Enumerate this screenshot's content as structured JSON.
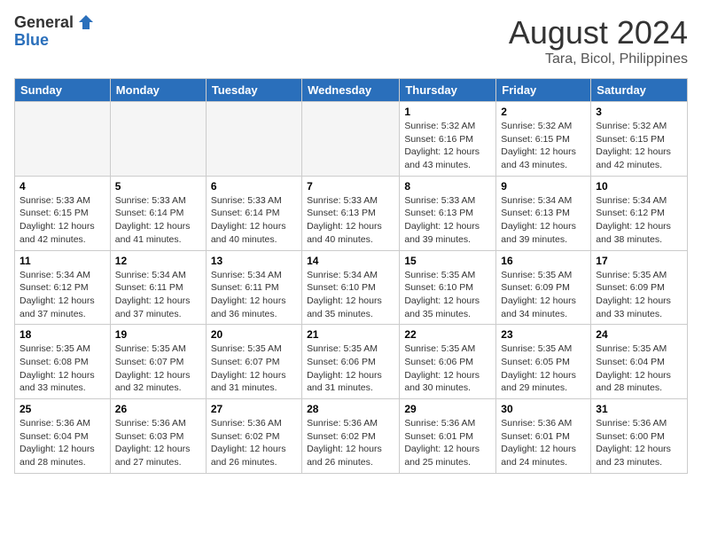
{
  "logo": {
    "general": "General",
    "blue": "Blue"
  },
  "title": {
    "month_year": "August 2024",
    "location": "Tara, Bicol, Philippines"
  },
  "days_of_week": [
    "Sunday",
    "Monday",
    "Tuesday",
    "Wednesday",
    "Thursday",
    "Friday",
    "Saturday"
  ],
  "weeks": [
    [
      {
        "day": "",
        "info": ""
      },
      {
        "day": "",
        "info": ""
      },
      {
        "day": "",
        "info": ""
      },
      {
        "day": "",
        "info": ""
      },
      {
        "day": "1",
        "info": "Sunrise: 5:32 AM\nSunset: 6:16 PM\nDaylight: 12 hours and 43 minutes."
      },
      {
        "day": "2",
        "info": "Sunrise: 5:32 AM\nSunset: 6:15 PM\nDaylight: 12 hours and 43 minutes."
      },
      {
        "day": "3",
        "info": "Sunrise: 5:32 AM\nSunset: 6:15 PM\nDaylight: 12 hours and 42 minutes."
      }
    ],
    [
      {
        "day": "4",
        "info": "Sunrise: 5:33 AM\nSunset: 6:15 PM\nDaylight: 12 hours and 42 minutes."
      },
      {
        "day": "5",
        "info": "Sunrise: 5:33 AM\nSunset: 6:14 PM\nDaylight: 12 hours and 41 minutes."
      },
      {
        "day": "6",
        "info": "Sunrise: 5:33 AM\nSunset: 6:14 PM\nDaylight: 12 hours and 40 minutes."
      },
      {
        "day": "7",
        "info": "Sunrise: 5:33 AM\nSunset: 6:13 PM\nDaylight: 12 hours and 40 minutes."
      },
      {
        "day": "8",
        "info": "Sunrise: 5:33 AM\nSunset: 6:13 PM\nDaylight: 12 hours and 39 minutes."
      },
      {
        "day": "9",
        "info": "Sunrise: 5:34 AM\nSunset: 6:13 PM\nDaylight: 12 hours and 39 minutes."
      },
      {
        "day": "10",
        "info": "Sunrise: 5:34 AM\nSunset: 6:12 PM\nDaylight: 12 hours and 38 minutes."
      }
    ],
    [
      {
        "day": "11",
        "info": "Sunrise: 5:34 AM\nSunset: 6:12 PM\nDaylight: 12 hours and 37 minutes."
      },
      {
        "day": "12",
        "info": "Sunrise: 5:34 AM\nSunset: 6:11 PM\nDaylight: 12 hours and 37 minutes."
      },
      {
        "day": "13",
        "info": "Sunrise: 5:34 AM\nSunset: 6:11 PM\nDaylight: 12 hours and 36 minutes."
      },
      {
        "day": "14",
        "info": "Sunrise: 5:34 AM\nSunset: 6:10 PM\nDaylight: 12 hours and 35 minutes."
      },
      {
        "day": "15",
        "info": "Sunrise: 5:35 AM\nSunset: 6:10 PM\nDaylight: 12 hours and 35 minutes."
      },
      {
        "day": "16",
        "info": "Sunrise: 5:35 AM\nSunset: 6:09 PM\nDaylight: 12 hours and 34 minutes."
      },
      {
        "day": "17",
        "info": "Sunrise: 5:35 AM\nSunset: 6:09 PM\nDaylight: 12 hours and 33 minutes."
      }
    ],
    [
      {
        "day": "18",
        "info": "Sunrise: 5:35 AM\nSunset: 6:08 PM\nDaylight: 12 hours and 33 minutes."
      },
      {
        "day": "19",
        "info": "Sunrise: 5:35 AM\nSunset: 6:07 PM\nDaylight: 12 hours and 32 minutes."
      },
      {
        "day": "20",
        "info": "Sunrise: 5:35 AM\nSunset: 6:07 PM\nDaylight: 12 hours and 31 minutes."
      },
      {
        "day": "21",
        "info": "Sunrise: 5:35 AM\nSunset: 6:06 PM\nDaylight: 12 hours and 31 minutes."
      },
      {
        "day": "22",
        "info": "Sunrise: 5:35 AM\nSunset: 6:06 PM\nDaylight: 12 hours and 30 minutes."
      },
      {
        "day": "23",
        "info": "Sunrise: 5:35 AM\nSunset: 6:05 PM\nDaylight: 12 hours and 29 minutes."
      },
      {
        "day": "24",
        "info": "Sunrise: 5:35 AM\nSunset: 6:04 PM\nDaylight: 12 hours and 28 minutes."
      }
    ],
    [
      {
        "day": "25",
        "info": "Sunrise: 5:36 AM\nSunset: 6:04 PM\nDaylight: 12 hours and 28 minutes."
      },
      {
        "day": "26",
        "info": "Sunrise: 5:36 AM\nSunset: 6:03 PM\nDaylight: 12 hours and 27 minutes."
      },
      {
        "day": "27",
        "info": "Sunrise: 5:36 AM\nSunset: 6:02 PM\nDaylight: 12 hours and 26 minutes."
      },
      {
        "day": "28",
        "info": "Sunrise: 5:36 AM\nSunset: 6:02 PM\nDaylight: 12 hours and 26 minutes."
      },
      {
        "day": "29",
        "info": "Sunrise: 5:36 AM\nSunset: 6:01 PM\nDaylight: 12 hours and 25 minutes."
      },
      {
        "day": "30",
        "info": "Sunrise: 5:36 AM\nSunset: 6:01 PM\nDaylight: 12 hours and 24 minutes."
      },
      {
        "day": "31",
        "info": "Sunrise: 5:36 AM\nSunset: 6:00 PM\nDaylight: 12 hours and 23 minutes."
      }
    ]
  ]
}
